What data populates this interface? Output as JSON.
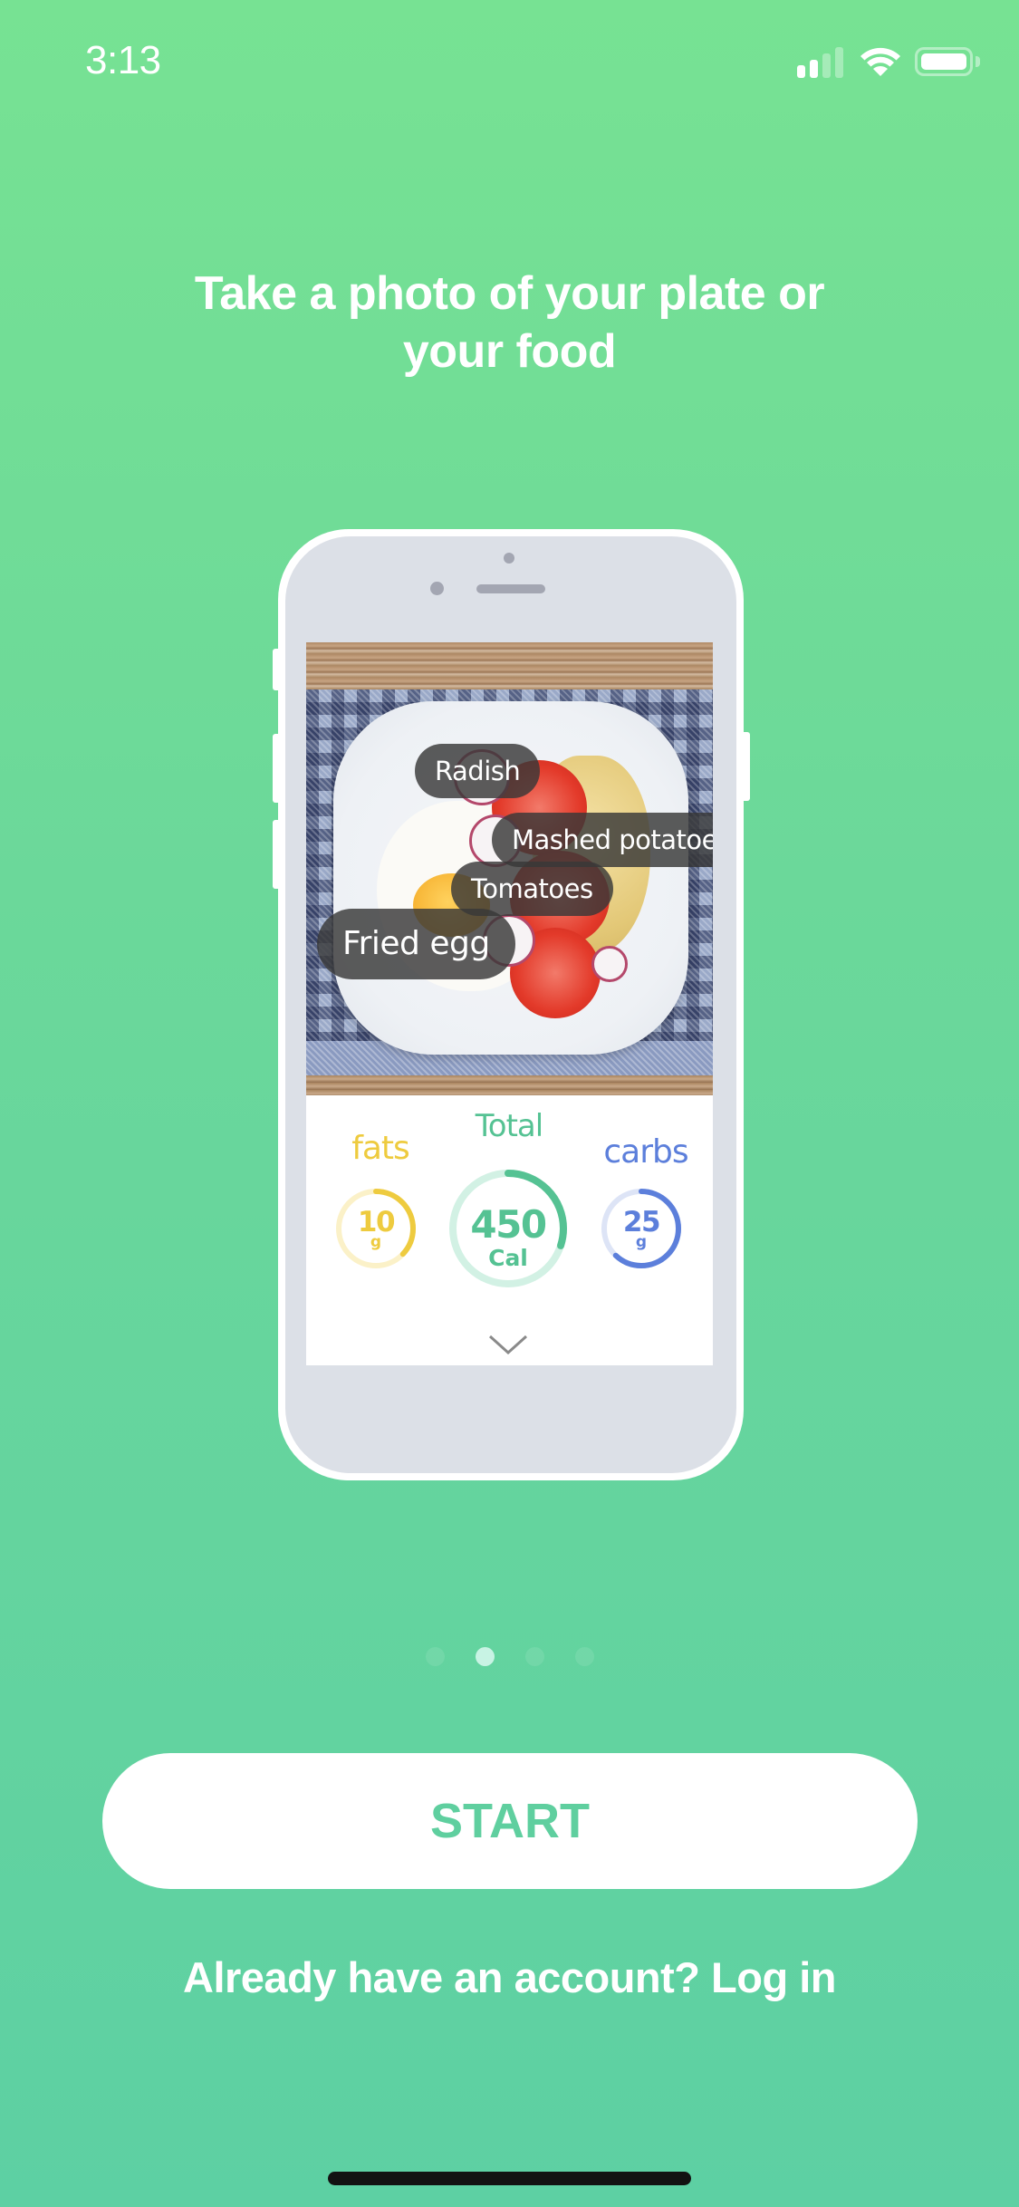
{
  "status_bar": {
    "time": "3:13",
    "signal_bars_active": 2,
    "signal_bars_total": 4,
    "icons": [
      "cellular-signal-icon",
      "wifi-icon",
      "battery-icon"
    ]
  },
  "onboarding": {
    "headline_line1": "Take a photo of your plate or",
    "headline_line2": "your food",
    "current_page": 2,
    "total_pages": 4
  },
  "illustration": {
    "food_tags": [
      {
        "label": "Radish"
      },
      {
        "label": "Mashed potatoes"
      },
      {
        "label": "Tomatoes"
      },
      {
        "label": "Fried egg"
      }
    ],
    "macros": {
      "fats": {
        "label": "fats",
        "value": "10",
        "unit": "g",
        "progress": 0.37,
        "color": "#eecb3f",
        "track": "#fbf1c8"
      },
      "total": {
        "label": "Total",
        "value": "450",
        "unit": "Cal",
        "progress": 0.3,
        "color": "#55c293",
        "track": "#d2f1e4"
      },
      "carbs": {
        "label": "carbs",
        "value": "25",
        "unit": "g",
        "progress": 0.62,
        "color": "#5c7fdb",
        "track": "#dde4f6"
      }
    },
    "expand_icon": "chevron-down-icon"
  },
  "actions": {
    "start_label": "START",
    "login_prompt": "Already have an account? Log in"
  },
  "colors": {
    "background_top": "#77e293",
    "background_bottom": "#5dd0a3",
    "accent": "#5fcf9f"
  }
}
